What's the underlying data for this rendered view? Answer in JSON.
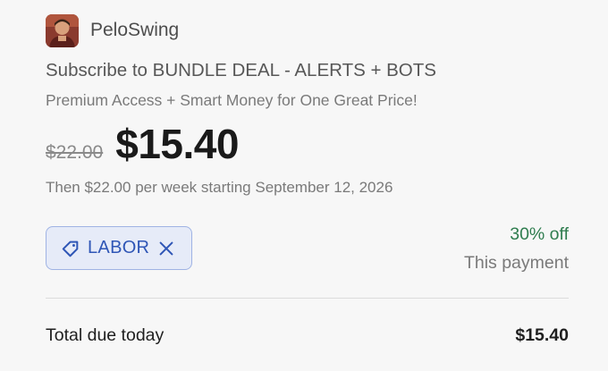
{
  "merchant": {
    "name": "PeloSwing",
    "avatar_icon": "merchant-avatar-photo"
  },
  "product": {
    "title": "Subscribe to BUNDLE DEAL - ALERTS + BOTS",
    "description": "Premium Access + Smart Money for One Great Price!"
  },
  "pricing": {
    "original_price": "$22.00",
    "current_price": "$15.40",
    "renewal_text": "Then $22.00 per week starting September 12, 2026"
  },
  "promo": {
    "code": "LABOR",
    "tag_icon": "tag-icon",
    "remove_icon": "close-icon",
    "discount_amount": "30% off",
    "discount_note": "This payment"
  },
  "total": {
    "label": "Total due today",
    "value": "$15.40"
  },
  "colors": {
    "background": "#f7f7f7",
    "promo_bg": "#e6ebf8",
    "promo_border": "#9fb3e4",
    "promo_text": "#2f56b6",
    "discount_green": "#2f7d4f"
  }
}
